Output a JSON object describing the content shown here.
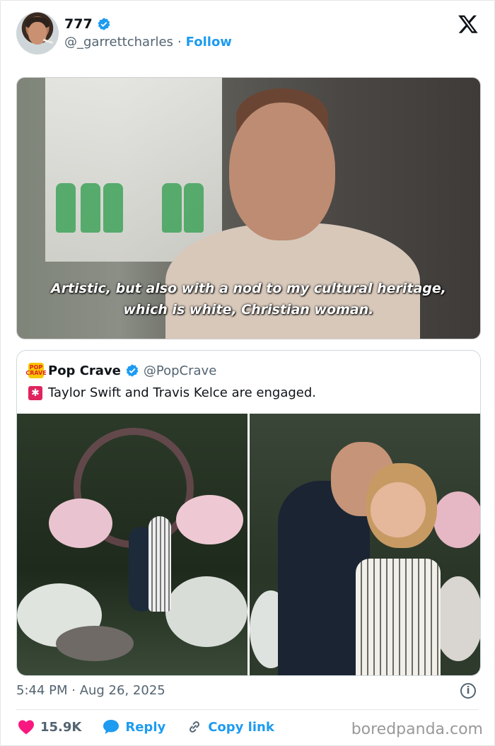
{
  "tweet": {
    "display_name": "777",
    "handle": "@_garrettcharles",
    "separator": "·",
    "follow_label": "Follow",
    "media_subtitle_line1": "Artistic, but also with a nod to my cultural heritage,",
    "media_subtitle_line2": "which is white, Christian woman.",
    "timestamp": "5:44 PM · Aug 26, 2025",
    "likes": "15.9K",
    "reply_label": "Reply",
    "copy_link_label": "Copy link"
  },
  "quoted": {
    "logo_text": "POP CRAVE",
    "display_name": "Pop Crave",
    "handle": "@PopCrave",
    "text": "Taylor Swift and Travis Kelce are engaged."
  },
  "icons": {
    "verified": "verified-badge-icon",
    "x": "x-logo-icon",
    "info": "info-icon",
    "heart": "heart-icon",
    "reply": "speech-bubble-icon",
    "link": "link-icon",
    "siren": "siren-emoji-icon"
  },
  "colors": {
    "accent": "#1d9bf0",
    "like": "#f91880",
    "muted": "#536471"
  },
  "watermark": "boredpanda.com"
}
